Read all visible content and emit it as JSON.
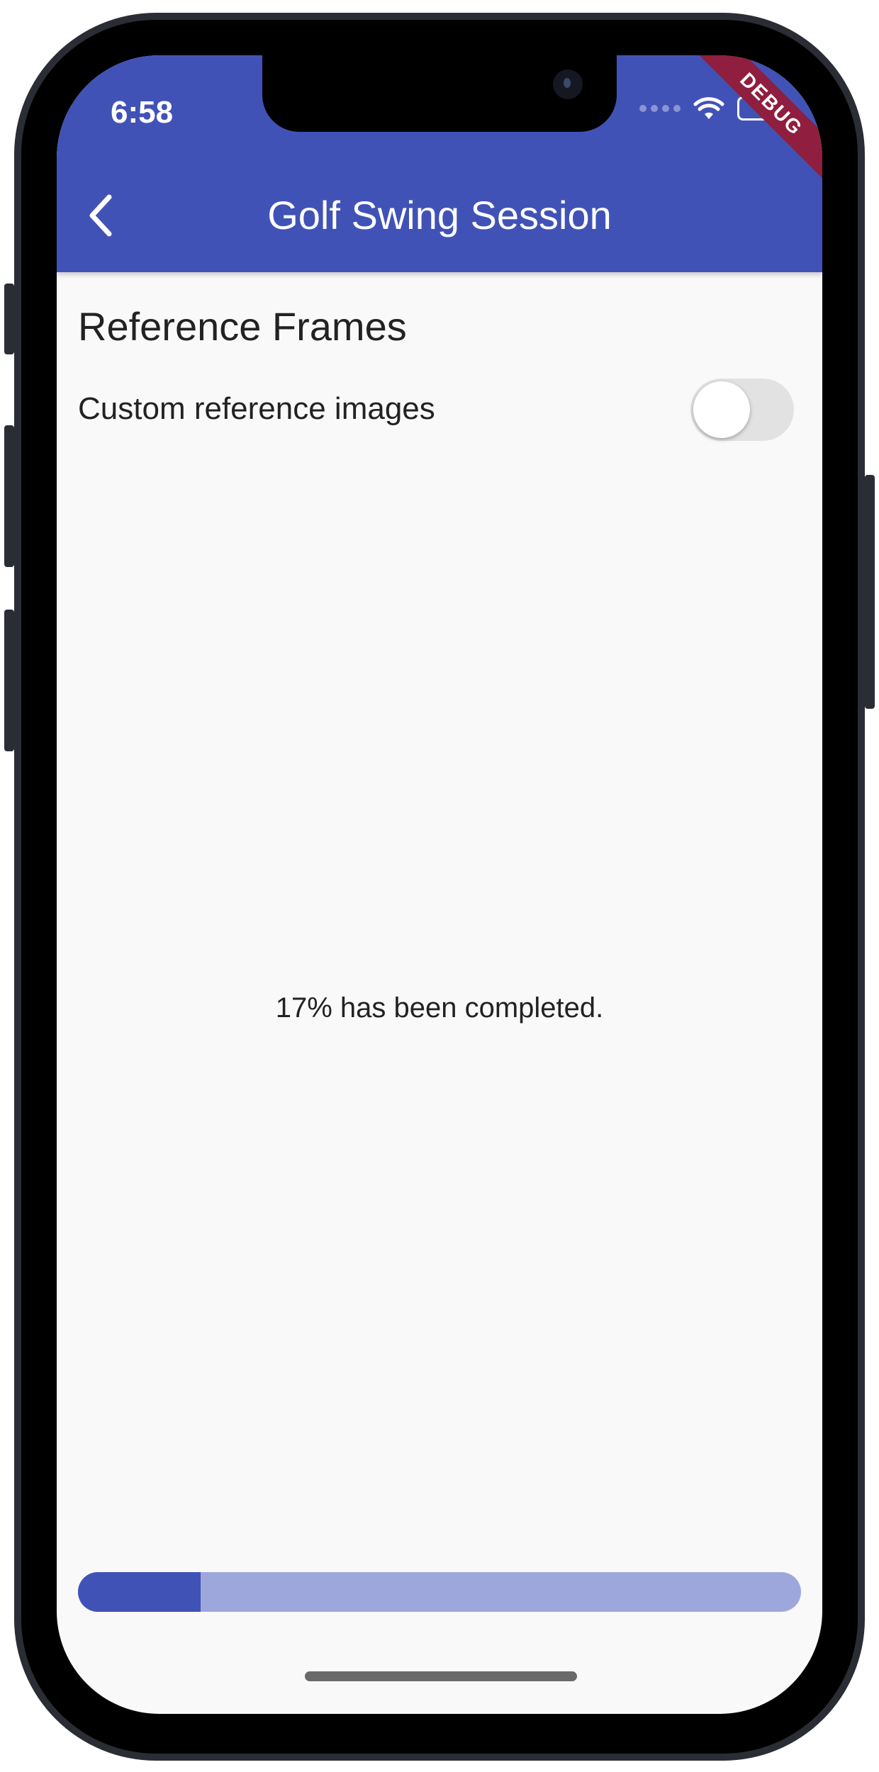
{
  "status_bar": {
    "time": "6:58"
  },
  "debug_banner": "DEBUG",
  "app_bar": {
    "title": "Golf Swing Session",
    "back_icon": "chevron-left-icon"
  },
  "reference": {
    "title": "Reference Frames",
    "custom_label": "Custom reference images",
    "custom_enabled": false
  },
  "progress": {
    "message": "17% has been completed.",
    "value": 0.17
  },
  "colors": {
    "primary": "#4152b7",
    "primary_light": "#9ea7db",
    "debug": "#8f1e3f",
    "background": "#f9f9f9"
  }
}
